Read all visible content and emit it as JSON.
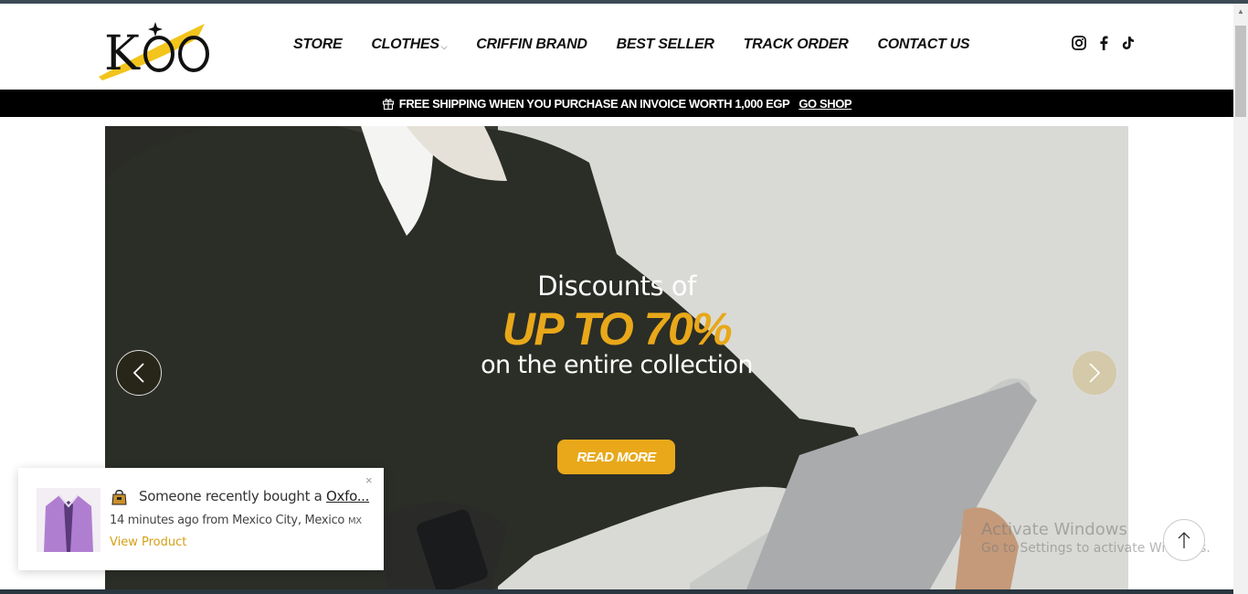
{
  "brand": {
    "logo_text": "KOO"
  },
  "nav": {
    "items": [
      {
        "label": "STORE"
      },
      {
        "label": "CLOTHES",
        "has_dropdown": true
      },
      {
        "label": "CRIFFIN BRAND"
      },
      {
        "label": "BEST SELLER"
      },
      {
        "label": "TRACK ORDER"
      },
      {
        "label": "CONTACT US"
      }
    ]
  },
  "social": {
    "icons": [
      "instagram-icon",
      "facebook-icon",
      "tiktok-icon"
    ]
  },
  "promo": {
    "text": "FREE SHIPPING WHEN YOU PURCHASE AN INVOICE WORTH 1,000 EGP",
    "link": "GO SHOP"
  },
  "hero": {
    "pre": "Discounts of",
    "main": "UP TO 70%",
    "sub": "on the entire collection",
    "cta": "READ MORE",
    "accent_color": "#e8a81a"
  },
  "popup": {
    "line1_prefix": "Someone recently bought a",
    "product": "Oxfo...",
    "time_location": "14 minutes ago from Mexico City, Mexico",
    "country_code": "MX",
    "view_label": "View Product",
    "close_label": "×"
  },
  "watermark": {
    "title": "Activate Windows",
    "subtitle": "Go to Settings to activate Windows."
  }
}
